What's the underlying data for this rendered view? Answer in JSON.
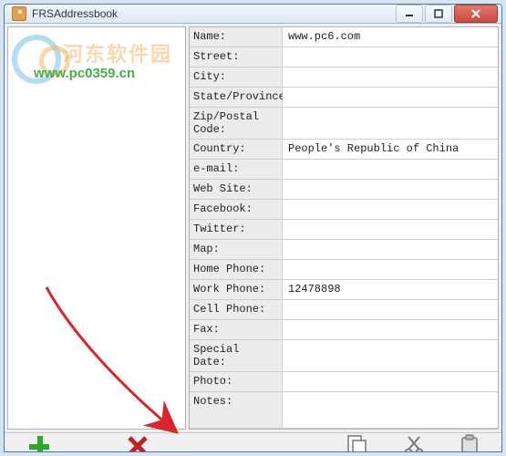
{
  "window": {
    "title": "FRSAddressbook"
  },
  "watermark": {
    "cn": "河东软件园",
    "url": "www.pc0359.cn"
  },
  "fields": [
    {
      "label": "Name:",
      "value": "www.pc6.com"
    },
    {
      "label": "Street:",
      "value": ""
    },
    {
      "label": "City:",
      "value": ""
    },
    {
      "label": "State/Province:",
      "value": ""
    },
    {
      "label": "Zip/Postal Code:",
      "value": ""
    },
    {
      "label": "Country:",
      "value": "People's Republic of China"
    },
    {
      "label": "e-mail:",
      "value": ""
    },
    {
      "label": "Web Site:",
      "value": ""
    },
    {
      "label": "Facebook:",
      "value": ""
    },
    {
      "label": "Twitter:",
      "value": ""
    },
    {
      "label": "Map:",
      "value": ""
    },
    {
      "label": "Home Phone:",
      "value": ""
    },
    {
      "label": "Work Phone:",
      "value": "12478898"
    },
    {
      "label": "Cell Phone:",
      "value": ""
    },
    {
      "label": "Fax:",
      "value": ""
    },
    {
      "label": "Special Date:",
      "value": ""
    },
    {
      "label": "Photo:",
      "value": ""
    },
    {
      "label": "Notes:",
      "value": "",
      "tall": true
    }
  ],
  "toolbar": {
    "add": "add",
    "delete": "delete",
    "copy": "copy",
    "cut": "cut",
    "paste": "paste"
  }
}
